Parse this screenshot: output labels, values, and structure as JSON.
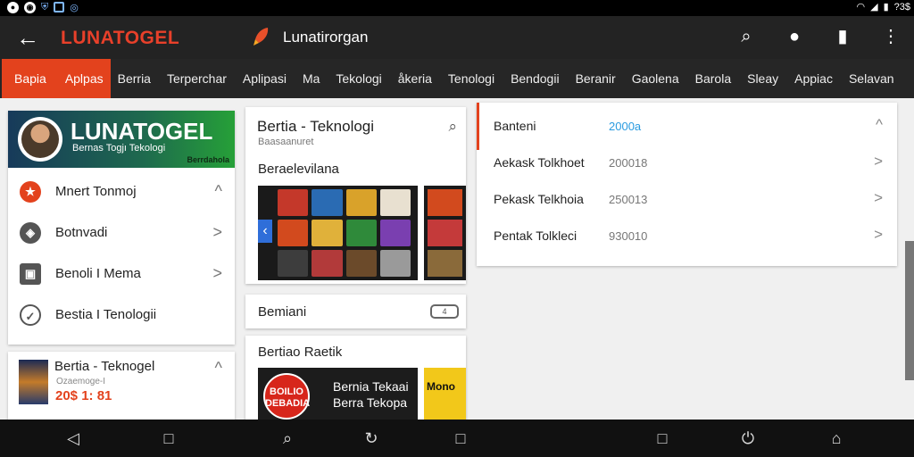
{
  "status_bar": {
    "left_icons": [
      "circle-b-icon",
      "circle-d-icon",
      "shield-icon",
      "image-icon",
      "chat-icon"
    ],
    "right_icons": [
      "wifi-icon",
      "signal-icon",
      "battery-icon"
    ],
    "right_text": "?3$"
  },
  "app_bar": {
    "brand": "LUNATOGEL",
    "title": "Lunatirorgan",
    "actions": [
      "search-icon",
      "account-icon",
      "bell-icon",
      "more-icon"
    ]
  },
  "tabs": [
    "Bapia",
    "Aplpas",
    "Berria",
    "Terperchar",
    "Aplipasi",
    "Ma",
    "Tekologi",
    "åkeria",
    "Tenologi",
    "Bendogii",
    "Beranir",
    "Gaolena",
    "Barola",
    "Sleay",
    "Appiac",
    "Selavan"
  ],
  "accent": "#e3421d",
  "left_panel": {
    "banner_title": "LUNATOGEL",
    "banner_sub": "Bernas Togjı Tekologi",
    "banner_tag": "Berrdahola",
    "items": [
      {
        "label": "Mnert Tonmoj",
        "icon": "star-icon",
        "chevron": "^"
      },
      {
        "label": "Botnvadi",
        "icon": "location-icon",
        "chevron": ">"
      },
      {
        "label": "Benoli I Mema",
        "icon": "bag-icon",
        "chevron": ">"
      },
      {
        "label": "Bestia I Tenologii",
        "icon": "clock-icon",
        "chevron": ""
      }
    ],
    "news_card": {
      "title": "Bertia - Teknogel",
      "sub": "Ozaemoge-I",
      "number": "20$ 1: 81"
    }
  },
  "middle_panel": {
    "card1": {
      "title": "Bertia - Teknologi",
      "sub": "Baasaanuret",
      "section": "Beraelevilana"
    },
    "card2": {
      "title": "Bemiani",
      "toggle": "4"
    },
    "card3": {
      "title": "Bertiao Raetik",
      "badge": "BOILIO DEBADIA",
      "promo_line1": "Bernia Tekaai",
      "promo_line2": "Berra Tekopa",
      "side_text": "Mono"
    }
  },
  "right_panel": {
    "rows": [
      {
        "label": "Banteni",
        "value": "2000a",
        "chevron": "^",
        "highlight": true
      },
      {
        "label": "Aekask Tolkhoet",
        "value": "200018",
        "chevron": ">",
        "highlight": false
      },
      {
        "label": "Pekask Telkhoia",
        "value": "250013",
        "chevron": ">",
        "highlight": false
      },
      {
        "label": "Pentak Tolkleci",
        "value": "930010",
        "chevron": ">",
        "highlight": false
      }
    ]
  },
  "nav_bar": [
    "back-icon",
    "square-icon",
    "search-icon",
    "refresh-icon",
    "square-icon",
    "square-icon",
    "power-icon",
    "home-icon"
  ]
}
